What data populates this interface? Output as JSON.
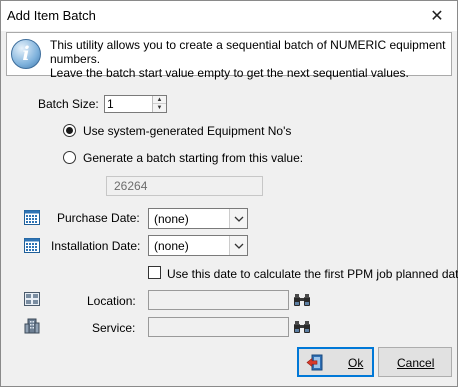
{
  "window": {
    "title": "Add Item Batch"
  },
  "info": {
    "line1": "This utility allows you to create a sequential batch of NUMERIC equipment numbers.",
    "line2": "Leave the batch start value empty to get the next sequential values."
  },
  "batch_size": {
    "label": "Batch Size:",
    "value": "1"
  },
  "options": {
    "system_generated": {
      "label": "Use system-generated Equipment No's",
      "selected": true
    },
    "starting_value": {
      "label": "Generate a batch starting from this value:",
      "selected": false,
      "value": "26264"
    }
  },
  "purchase_date": {
    "label": "Purchase Date:",
    "value": "(none)"
  },
  "installation_date": {
    "label": "Installation Date:",
    "value": "(none)"
  },
  "ppm_checkbox": {
    "label": "Use this date to calculate the first PPM job planned date",
    "checked": false
  },
  "location": {
    "label": "Location:",
    "value": ""
  },
  "service": {
    "label": "Service:",
    "value": ""
  },
  "buttons": {
    "ok": "Ok",
    "cancel": "Cancel"
  },
  "icons": {
    "info": "info-icon",
    "calendar": "calendar-icon",
    "binoculars": "binoculars-icon",
    "location": "location-icon",
    "service": "building-icon",
    "ok": "exit-door-icon"
  }
}
